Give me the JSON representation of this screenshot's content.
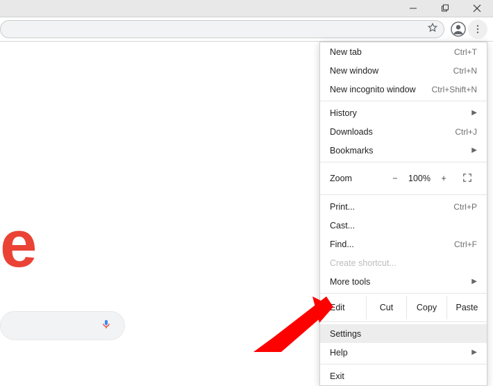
{
  "menu": {
    "new_tab": {
      "label": "New tab",
      "shortcut": "Ctrl+T"
    },
    "new_window": {
      "label": "New window",
      "shortcut": "Ctrl+N"
    },
    "new_incognito": {
      "label": "New incognito window",
      "shortcut": "Ctrl+Shift+N"
    },
    "history": {
      "label": "History"
    },
    "downloads": {
      "label": "Downloads",
      "shortcut": "Ctrl+J"
    },
    "bookmarks": {
      "label": "Bookmarks"
    },
    "zoom": {
      "label": "Zoom",
      "value": "100%",
      "minus": "−",
      "plus": "+"
    },
    "print": {
      "label": "Print...",
      "shortcut": "Ctrl+P"
    },
    "cast": {
      "label": "Cast..."
    },
    "find": {
      "label": "Find...",
      "shortcut": "Ctrl+F"
    },
    "create_shortcut": {
      "label": "Create shortcut..."
    },
    "more_tools": {
      "label": "More tools"
    },
    "edit": {
      "label": "Edit",
      "cut": "Cut",
      "copy": "Copy",
      "paste": "Paste"
    },
    "settings": {
      "label": "Settings"
    },
    "help": {
      "label": "Help"
    },
    "exit": {
      "label": "Exit"
    }
  },
  "colors": {
    "red_e": "#ea4335",
    "arrow": "#ff0000"
  }
}
